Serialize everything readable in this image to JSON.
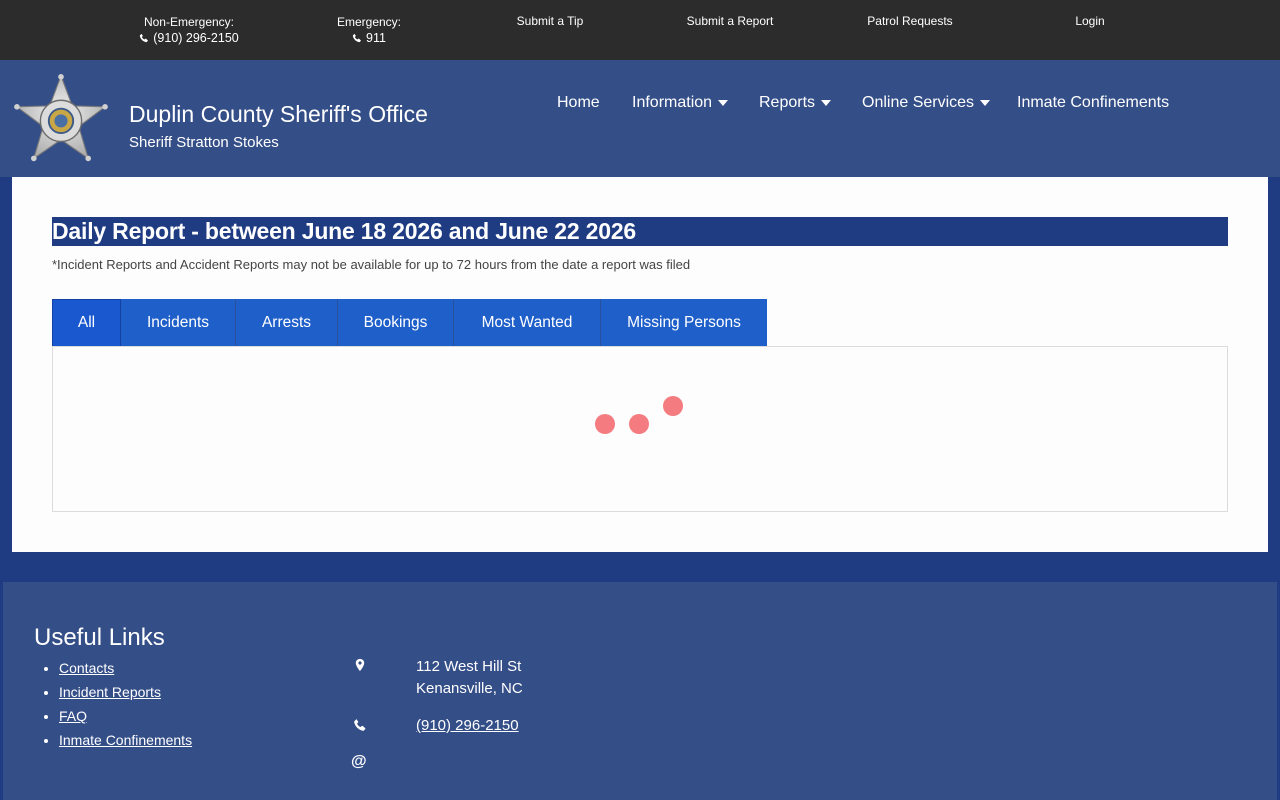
{
  "topbar": {
    "non_emergency_label": "Non-Emergency:",
    "non_emergency_phone": "(910) 296-2150",
    "emergency_label": "Emergency:",
    "emergency_phone": "911",
    "submit_tip": "Submit a Tip",
    "submit_report": "Submit a Report",
    "patrol_requests": "Patrol Requests",
    "login": "Login"
  },
  "header": {
    "title": "Duplin County Sheriff's Office",
    "subtitle": "Sheriff Stratton Stokes",
    "badge_icon": "sheriff-star-badge",
    "nav": [
      {
        "label": "Home",
        "dropdown": false
      },
      {
        "label": "Information",
        "dropdown": true
      },
      {
        "label": "Reports",
        "dropdown": true
      },
      {
        "label": "Online Services",
        "dropdown": true
      },
      {
        "label": "Inmate Confinements",
        "dropdown": false
      }
    ]
  },
  "main": {
    "report_title": "Daily Report - between June 18 2026 and June 22 2026",
    "note": "*Incident Reports and Accident Reports may not be available for up to 72 hours from the date a report was filed",
    "tabs": [
      {
        "label": "All",
        "active": true
      },
      {
        "label": "Incidents",
        "active": false
      },
      {
        "label": "Arrests",
        "active": false
      },
      {
        "label": "Bookings",
        "active": false
      },
      {
        "label": "Most Wanted",
        "active": false
      },
      {
        "label": "Missing Persons",
        "active": false
      }
    ],
    "loader_color": "#f47c80"
  },
  "footer": {
    "title": "Useful Links",
    "links": [
      "Contacts",
      "Incident Reports",
      "FAQ",
      "Inmate Confinements"
    ],
    "address_line1": "112 West Hill St",
    "address_line2": "Kenansville, NC",
    "phone": "(910) 296-2150",
    "email_icon": "at-icon"
  },
  "colors": {
    "topbar_bg": "#2c2c2c",
    "header_bg": "#344e88",
    "accent_blue": "#1f3b82",
    "tab_blue": "#1f5fc9"
  }
}
